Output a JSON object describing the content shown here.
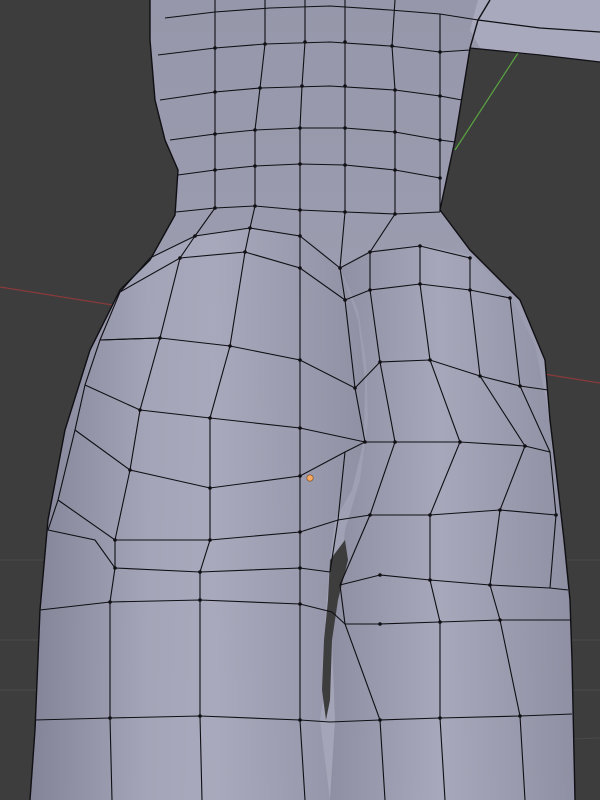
{
  "viewport": {
    "background_color": "#3d3d3d",
    "mesh_fill_color": "#9a9bae",
    "mesh_wire_color": "#0f0f14",
    "axis_x_color": "#8a3a3a",
    "axis_y_color": "#5aa640",
    "selected_vertex_color": "#f6a860",
    "mode": "edit-mode-wireframe",
    "selected_vertex_count": 1
  }
}
